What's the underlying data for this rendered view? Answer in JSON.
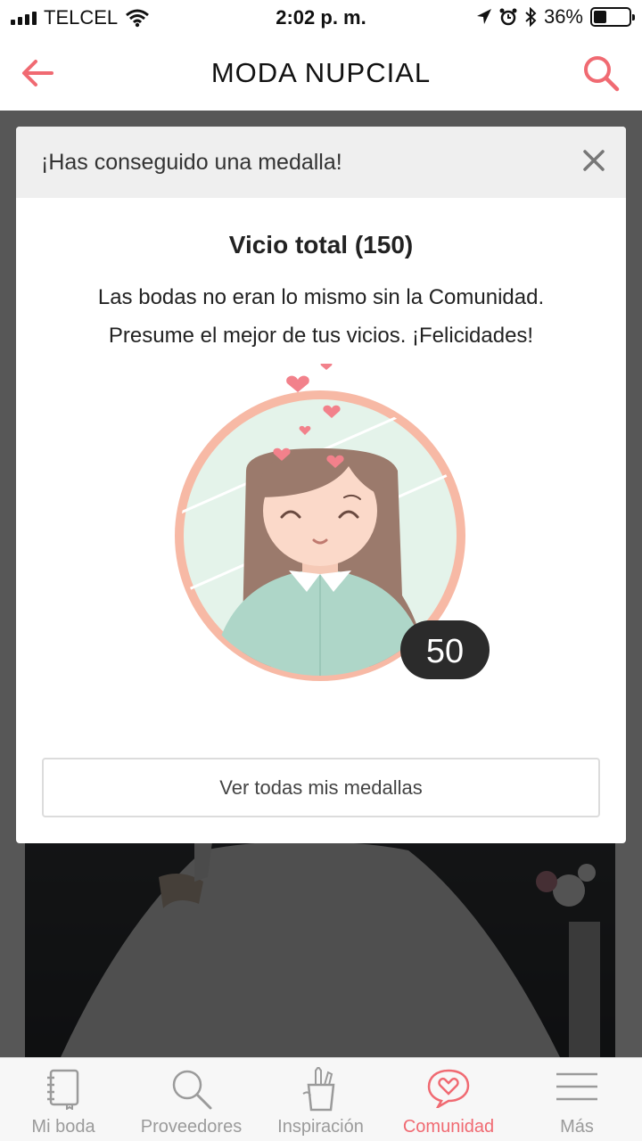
{
  "status_bar": {
    "carrier": "TELCEL",
    "time": "2:02 p. m.",
    "battery": "36%",
    "battery_level": 0.36
  },
  "header": {
    "title": "MODA NUPCIAL",
    "back_icon": "arrow-left-icon",
    "search_icon": "search-icon",
    "accent_color": "#f06a72"
  },
  "modal": {
    "heading": "¡Has conseguido una medalla!",
    "medal_name": "Vicio total (150)",
    "description_line1": "Las bodas no eran lo mismo sin la Comunidad.",
    "description_line2": "Presume el mejor de tus vicios. ¡Felicidades!",
    "badge_count": "50",
    "button_label": "Ver todas mis medallas"
  },
  "tabs": [
    {
      "label": "Mi boda",
      "icon": "notebook-icon",
      "active": false
    },
    {
      "label": "Proveedores",
      "icon": "search-icon",
      "active": false
    },
    {
      "label": "Inspiración",
      "icon": "pencil-cup-icon",
      "active": false
    },
    {
      "label": "Comunidad",
      "icon": "heart-chat-icon",
      "active": true
    },
    {
      "label": "Más",
      "icon": "menu-icon",
      "active": false
    }
  ]
}
